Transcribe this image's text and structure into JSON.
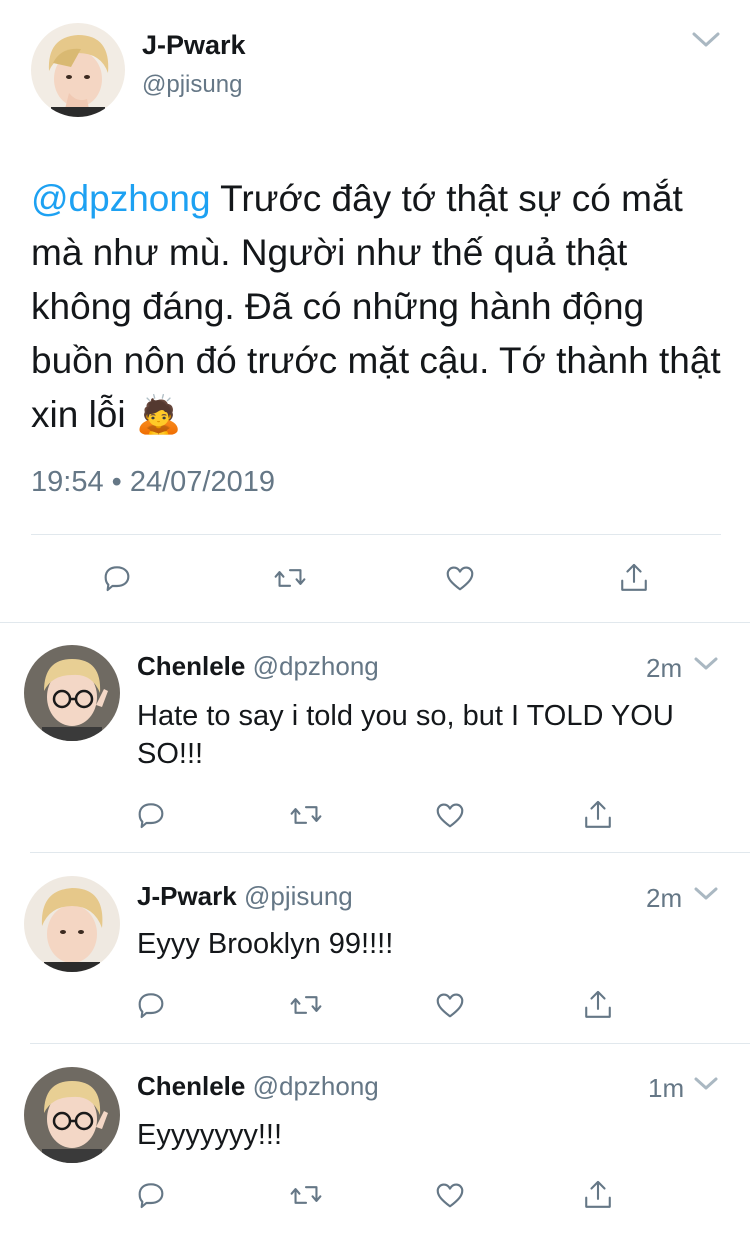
{
  "main_tweet": {
    "name": "J-Pwark",
    "handle": "@pjisung",
    "mention": "@dpzhong",
    "text": " Trước đây tớ thật sự có mắt mà như mù. Người như thế quả thật không đáng. Đã có những hành động buồn nôn đó trước mặt cậu. Tớ thành thật xin lỗi ",
    "emoji": "🙇",
    "time": "19:54 • 24/07/2019"
  },
  "replies": [
    {
      "name": "Chenlele",
      "handle": "@dpzhong",
      "time": "2m",
      "text": "Hate to say i told you so, but I TOLD YOU SO!!!",
      "avatar": "glasses"
    },
    {
      "name": "J-Pwark",
      "handle": "@pjisung",
      "time": "2m",
      "text": "Eyyy Brooklyn 99!!!!",
      "avatar": "blond"
    },
    {
      "name": "Chenlele",
      "handle": "@dpzhong",
      "time": "1m",
      "text": "Eyyyyyyy!!!",
      "avatar": "glasses"
    }
  ],
  "icons": {
    "reply": "reply-icon",
    "retweet": "retweet-icon",
    "like": "heart-icon",
    "share": "share-icon",
    "menu": "chevron-down-icon"
  },
  "colors": {
    "mention": "#1da1f2",
    "muted": "#657786",
    "text": "#14171a",
    "divider": "#e1e8ed"
  }
}
